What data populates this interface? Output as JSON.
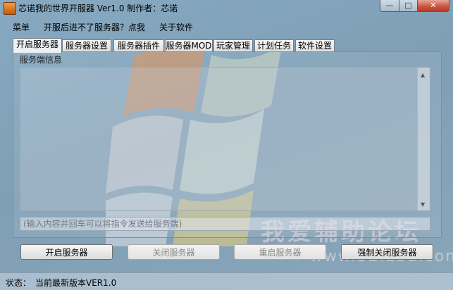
{
  "window": {
    "title": "芯诺我的世界开服器 Ver1.0 制作者：芯诺",
    "controls": {
      "minimize": "—",
      "maximize": "□",
      "close": "✕"
    }
  },
  "menu": [
    "菜单",
    "开服后进不了服务器？点我",
    "关于软件"
  ],
  "tabs": [
    {
      "label": "开启服务器",
      "active": true
    },
    {
      "label": "服务器设置",
      "active": false
    },
    {
      "label": "服务器插件",
      "active": false
    },
    {
      "label": "服务器MOD",
      "active": false
    },
    {
      "label": "玩家管理",
      "active": false
    },
    {
      "label": "计划任务",
      "active": false
    },
    {
      "label": "软件设置",
      "active": false
    }
  ],
  "server_info": {
    "label": "服务端信息",
    "output_text": ""
  },
  "command_input": {
    "value": "",
    "placeholder": "(输入内容并回车可以将指令发送给服务端)"
  },
  "buttons": {
    "start": "开启服务器",
    "stop": "关闭服务器",
    "restart": "重启服务器",
    "force_stop": "强制关闭服务器"
  },
  "status": {
    "label": "状态：",
    "text": "当前最新版本VER1.0"
  },
  "watermark": {
    "text": "我爱辅助论坛",
    "url": "www.52fzba.com"
  },
  "colors": {
    "background": "#7f9fb6",
    "close_button": "#c7523f"
  }
}
